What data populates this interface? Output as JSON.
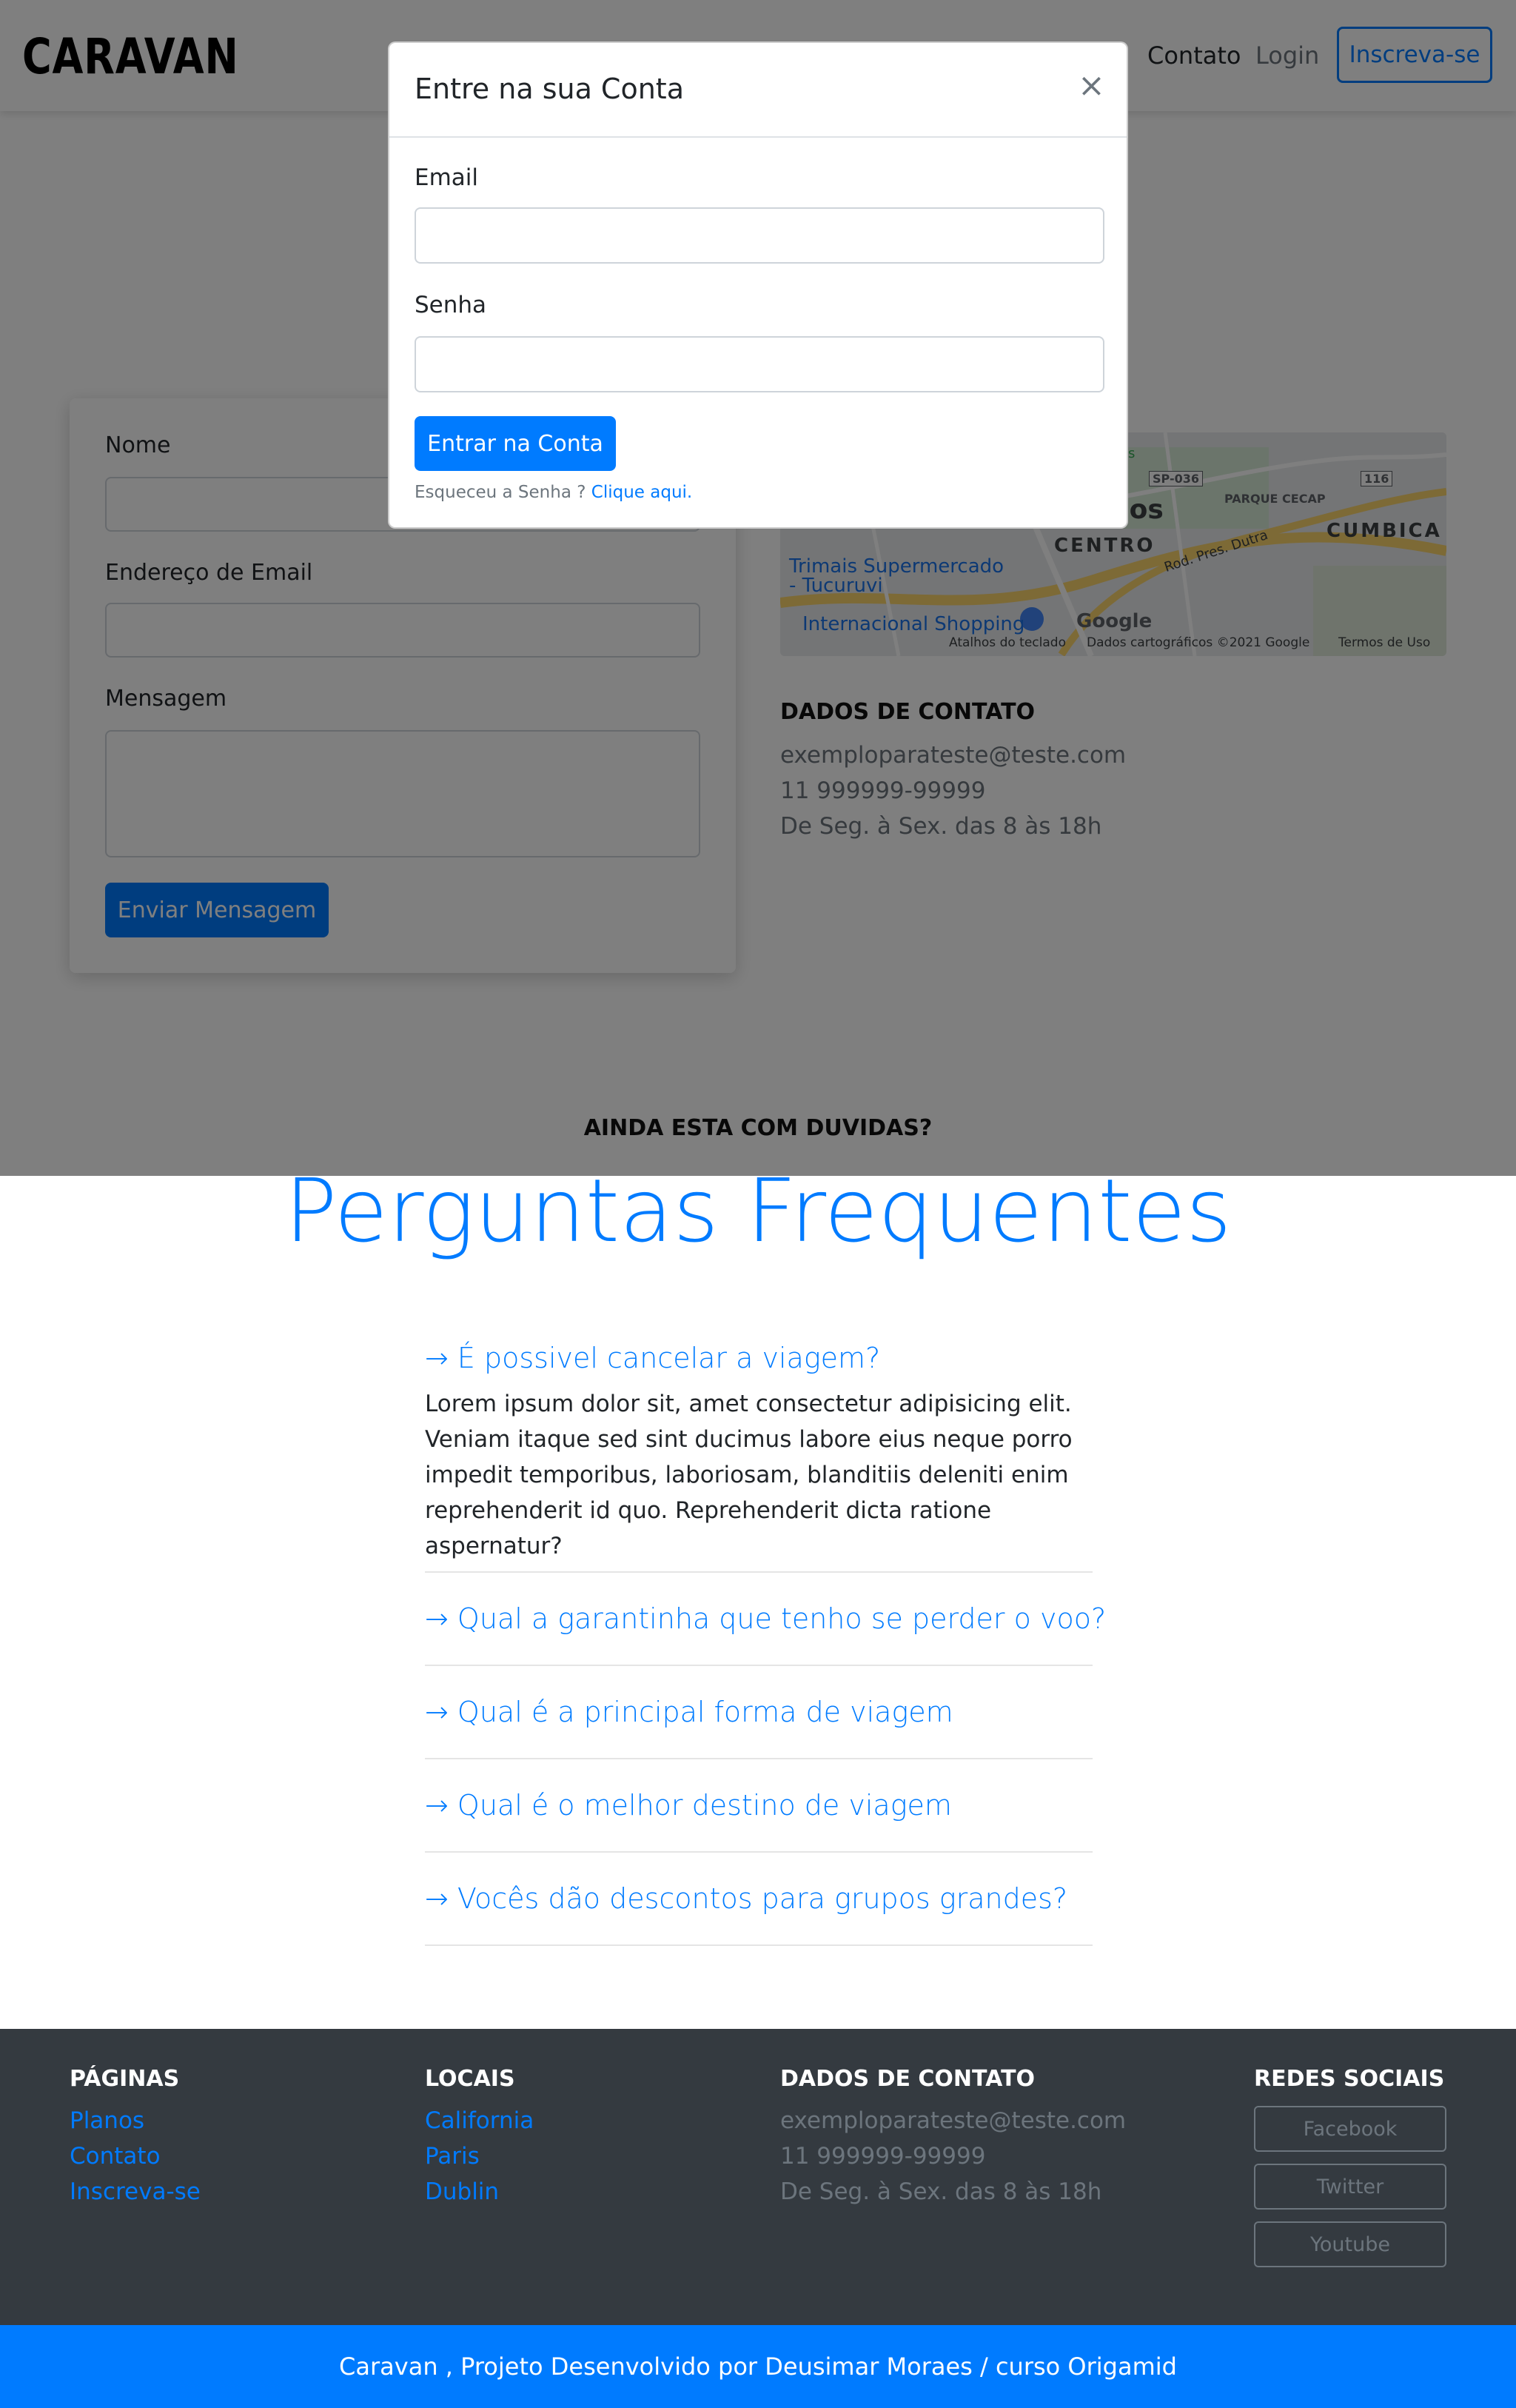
{
  "header": {
    "logo": "CARAVAN",
    "nav": {
      "contato": "Contato",
      "login": "Login",
      "signup": "Inscreva-se"
    }
  },
  "contact_form": {
    "name_label": "Nome",
    "email_label": "Endereço de Email",
    "message_label": "Mensagem",
    "submit": "Enviar Mensagem"
  },
  "map": {
    "labels": {
      "area1": "hos",
      "centro": "CENTRO",
      "cumbica": "CUMBICA",
      "parque": "PARQUE CECAP",
      "road": "Rod. Pres. Dutra",
      "sp": "SP-036",
      "route": "116",
      "s": "s",
      "supermarket": "Trimais Supermercado\n- Tucuruvi",
      "shopping": "Internacional Shopping",
      "google": "Google",
      "shortcuts": "Atalhos do teclado",
      "mapdata": "Dados cartográficos ©2021 Google",
      "terms": "Termos de Uso"
    }
  },
  "contact_info": {
    "title": "DADOS DE CONTATO",
    "email": "exemploparateste@teste.com",
    "phone": "11 999999-99999",
    "hours": "De Seg. à Sex. das 8 às 18h"
  },
  "duvidas": "AINDA ESTA COM DUVIDAS?",
  "modal": {
    "title": "Entre na sua Conta",
    "close": "×",
    "email_label": "Email",
    "password_label": "Senha",
    "submit": "Entrar na Conta",
    "forgot_text": "Esqueceu a Senha ?",
    "forgot_link": "Clique aqui."
  },
  "faq": {
    "title": "Perguntas Frequentes",
    "items": [
      {
        "question": "→ É possivel cancelar a viagem?"
      },
      {
        "question": "→ Qual a garantinha que tenho se perder o voo?"
      },
      {
        "question": "→ Qual é a principal forma de viagem"
      },
      {
        "question": "→ Qual é o melhor destino de viagem"
      },
      {
        "question": "→ Vocês dão descontos para grupos grandes?"
      }
    ],
    "answer": "Lorem ipsum dolor sit, amet consectetur adipisicing elit. Veniam itaque sed sint ducimus labore eius neque porro impedit temporibus, laboriosam, blanditiis deleniti enim reprehenderit id quo. Reprehenderit dicta ratione aspernatur?"
  },
  "footer": {
    "pages": {
      "title": "PÁGINAS",
      "links": [
        "Planos",
        "Contato",
        "Inscreva-se"
      ]
    },
    "places": {
      "title": "LOCAIS",
      "links": [
        "California",
        "Paris",
        "Dublin"
      ]
    },
    "contact": {
      "title": "DADOS DE CONTATO",
      "email": "exemploparateste@teste.com",
      "phone": "11 999999-99999",
      "hours": "De Seg. à Sex. das 8 às 18h"
    },
    "social": {
      "title": "REDES SOCIAIS",
      "buttons": [
        "Facebook",
        "Twitter",
        "Youtube"
      ]
    },
    "bottom": "Caravan , Projeto Desenvolvido por Deusimar Moraes / curso Origamid"
  },
  "colors": {
    "primary": "#007bff",
    "dark": "#343a40",
    "muted": "#6c757d",
    "overlay": "rgba(0,0,0,0.5)"
  }
}
